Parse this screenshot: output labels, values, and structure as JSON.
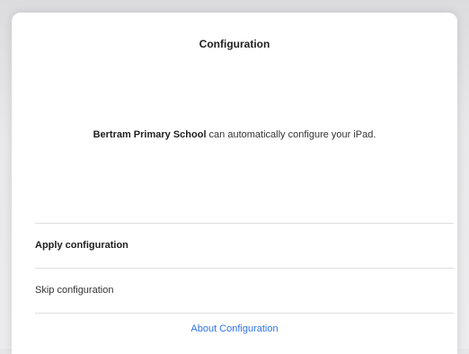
{
  "dialog": {
    "title": "Configuration",
    "message": {
      "organization": "Bertram Primary School",
      "text": " can automatically configure your iPad."
    },
    "options": [
      {
        "label": "Apply configuration"
      },
      {
        "label": "Skip configuration"
      }
    ],
    "about_link": "About Configuration",
    "colors": {
      "link": "#2f74e8",
      "background": "#ffffff",
      "divider": "#dedede"
    }
  }
}
